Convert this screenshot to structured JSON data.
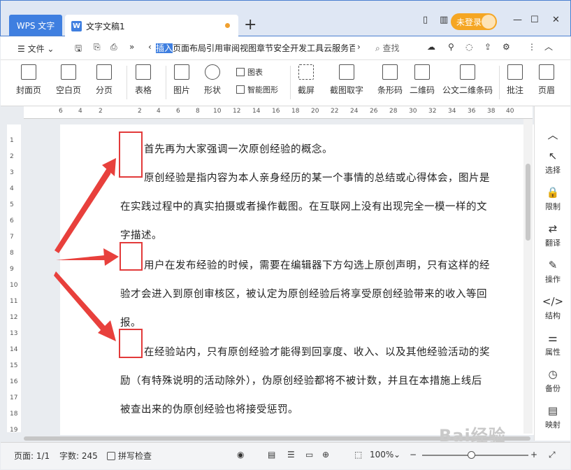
{
  "titlebar": {
    "home_tab": "WPS 文字",
    "doc_tab": "文字文稿1",
    "login": "未登录"
  },
  "menubar": {
    "file": "文件",
    "tabs": [
      "插入",
      "页面布局",
      "引用",
      "审阅",
      "视图",
      "章节",
      "安全",
      "开发工具",
      "云服务",
      "百"
    ],
    "active_tab": "插入",
    "search": "查找"
  },
  "ribbon": {
    "cover": "封面页",
    "blank": "空白页",
    "pagebreak": "分页",
    "table": "表格",
    "picture": "图片",
    "shape": "形状",
    "icons": "图表",
    "smartart": "智能图形",
    "screenshot": "截屏",
    "ocr": "截图取字",
    "barcode": "条形码",
    "qrcode": "二维码",
    "pdf417": "公文二维条码",
    "comment": "批注",
    "header": "页眉"
  },
  "ruler": {
    "marks": [
      "6",
      "4",
      "2",
      "2",
      "4",
      "6",
      "8",
      "10",
      "12",
      "14",
      "16",
      "18",
      "20",
      "22",
      "24",
      "26",
      "28",
      "30",
      "32",
      "34",
      "36",
      "38",
      "40"
    ]
  },
  "vruler": {
    "marks": [
      "1",
      "2",
      "3",
      "4",
      "5",
      "6",
      "7",
      "8",
      "9",
      "10",
      "11",
      "12",
      "13",
      "14",
      "15",
      "16",
      "17",
      "18",
      "19"
    ]
  },
  "document": {
    "p1": "首先再为大家强调一次原创经验的概念。",
    "p2_l1": "原创经验是指内容为本人亲身经历的某一个事情的总结或心得体会，图片是",
    "p2_l2": "在实践过程中的真实拍摄或者操作截图。在互联网上没有出现完全一模一样的文",
    "p2_l3": "字描述。",
    "p3_l1": "用户在发布经验的时候，需要在编辑器下方勾选上原创声明，只有这样的经",
    "p3_l2": "验才会进入到原创审核区，被认定为原创经验后将享受原创经验带来的收入等回",
    "p3_l3": "报。",
    "p4_l1": "在经验站内，只有原创经验才能得到回享度、收入、以及其他经验活动的奖",
    "p4_l2": "励（有特殊说明的活动除外），伪原创经验都将不被计数，并且在本措施上线后",
    "p4_l3": "被查出来的伪原创经验也将接受惩罚。"
  },
  "rightpane": {
    "select": "选择",
    "limit": "限制",
    "translate": "翻译",
    "operate": "操作",
    "structure": "结构",
    "attributes": "属性",
    "backup": "备份",
    "map": "映射"
  },
  "statusbar": {
    "page": "页面: 1/1",
    "words": "字数: 245",
    "spell": "拼写检查",
    "zoom": "100%"
  },
  "watermark": "Bai经验"
}
